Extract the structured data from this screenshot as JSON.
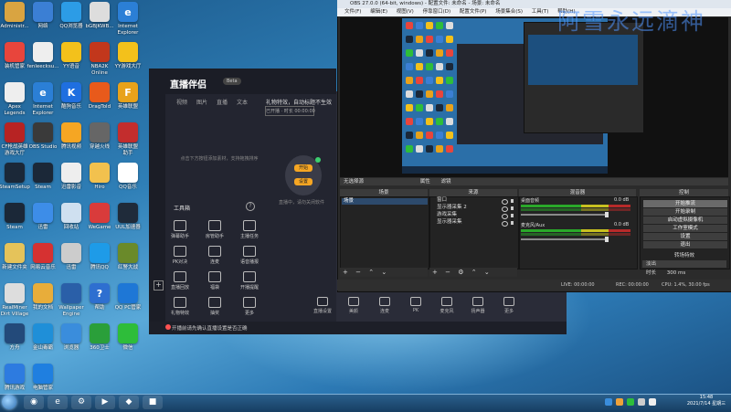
{
  "desktop_icons": [
    {
      "label": "Administr...",
      "color": "#d9a441",
      "glyph": ""
    },
    {
      "label": "网络",
      "color": "#3b7fd4",
      "glyph": ""
    },
    {
      "label": "QQ浏览器",
      "color": "#2c9ce6",
      "glyph": ""
    },
    {
      "label": "bGBJKWB...",
      "color": "#dddddd",
      "glyph": ""
    },
    {
      "label": "Internet\nExplorer",
      "color": "#2b7fd6",
      "glyph": "e"
    },
    {
      "label": "装机管家",
      "color": "#e8453c",
      "glyph": ""
    },
    {
      "label": "fenleecksu...",
      "color": "#eeeeee",
      "glyph": ""
    },
    {
      "label": "YY语音",
      "color": "#f3c11b",
      "glyph": ""
    },
    {
      "label": "NBA2K\nOnline",
      "color": "#c2371c",
      "glyph": ""
    },
    {
      "label": "YY游戏大厅",
      "color": "#f3c11b",
      "glyph": ""
    },
    {
      "label": "Apex\nLegends",
      "color": "#eeeeee",
      "glyph": ""
    },
    {
      "label": "Internet\nExplorer",
      "color": "#2b7fd6",
      "glyph": "e"
    },
    {
      "label": "酷狗音乐",
      "color": "#1f6fe0",
      "glyph": "K"
    },
    {
      "label": "DragTold",
      "color": "#e85a1b",
      "glyph": ""
    },
    {
      "label": "英雄联盟",
      "color": "#e8a21b",
      "glyph": "F"
    },
    {
      "label": "CF枪战英雄\n游戏大厅",
      "color": "#b72323",
      "glyph": ""
    },
    {
      "label": "OBS Studio",
      "color": "#3a3a3a",
      "glyph": ""
    },
    {
      "label": "腾讯视频",
      "color": "#f5a623",
      "glyph": ""
    },
    {
      "label": "穿越火线",
      "color": "#666666",
      "glyph": ""
    },
    {
      "label": "英雄联盟\n助手",
      "color": "#c32d2d",
      "glyph": ""
    },
    {
      "label": "SteamSetup",
      "color": "#1b2838",
      "glyph": ""
    },
    {
      "label": "Steam",
      "color": "#1b2838",
      "glyph": ""
    },
    {
      "label": "迅雷影音",
      "color": "#eeeeee",
      "glyph": ""
    },
    {
      "label": "Hiro",
      "color": "#f2c14e",
      "glyph": ""
    },
    {
      "label": "QQ音乐",
      "color": "#ffffff",
      "glyph": ""
    },
    {
      "label": "Steam",
      "color": "#1b2838",
      "glyph": ""
    },
    {
      "label": "迅雷",
      "color": "#3d8de8",
      "glyph": ""
    },
    {
      "label": "回收站",
      "color": "#cfe0f0",
      "glyph": ""
    },
    {
      "label": "WeGame",
      "color": "#d93b3b",
      "glyph": ""
    },
    {
      "label": "UUL加速器",
      "color": "#1f2b3a",
      "glyph": ""
    },
    {
      "label": "新建文件夹",
      "color": "#e5c35a",
      "glyph": ""
    },
    {
      "label": "网易云音乐",
      "color": "#d63131",
      "glyph": ""
    },
    {
      "label": "迅雷",
      "color": "#cccccc",
      "glyph": ""
    },
    {
      "label": "腾讯QQ",
      "color": "#1e9be8",
      "glyph": ""
    },
    {
      "label": "红警大战",
      "color": "#6a8a2a",
      "glyph": ""
    },
    {
      "label": "RealMiner\nDirt Village",
      "color": "#dddddd",
      "glyph": ""
    },
    {
      "label": "我的文档",
      "color": "#e8ad3a",
      "glyph": ""
    },
    {
      "label": "Wallpaper\nEngine",
      "color": "#2a5fa8",
      "glyph": ""
    },
    {
      "label": "帮助",
      "color": "#2e6fd0",
      "glyph": "?"
    },
    {
      "label": "QQ PC管家",
      "color": "#1e77d6",
      "glyph": ""
    },
    {
      "label": "方舟",
      "color": "#234a7a",
      "glyph": ""
    },
    {
      "label": "金山毒霸",
      "color": "#1f8fd8",
      "glyph": ""
    },
    {
      "label": "浏览器",
      "color": "#3a8ddc",
      "glyph": ""
    },
    {
      "label": "360卫士",
      "color": "#2a9f3a",
      "glyph": ""
    },
    {
      "label": "微信",
      "color": "#2ebd3a",
      "glyph": ""
    },
    {
      "label": "腾讯游戏",
      "color": "#2d7be0",
      "glyph": ""
    },
    {
      "label": "电脑管家",
      "color": "#1f7fe0",
      "glyph": ""
    }
  ],
  "stream_app": {
    "brand": "直播伴侣",
    "brand_badge": "Beta",
    "tabs": [
      "视频",
      "图片",
      "直播",
      "文本"
    ],
    "right_header": "礼物特效，自动标题不生效",
    "right_sub": "已开播 · 时长 00:00:00",
    "empty_hint": "点击下方按钮添加素材，支持拖拽排序",
    "toolbox_title": "工具箱",
    "tools": [
      {
        "label": "弹幕助手"
      },
      {
        "label": "房管助手"
      },
      {
        "label": "主播任务"
      },
      {
        "label": "PK对决"
      },
      {
        "label": "连麦"
      },
      {
        "label": "语音播报"
      },
      {
        "label": "直播回放"
      },
      {
        "label": "福袋"
      },
      {
        "label": "开播提醒"
      },
      {
        "label": "礼物特效"
      },
      {
        "label": "抽奖"
      },
      {
        "label": "更多"
      }
    ],
    "orange_buttons": [
      "开始",
      "设置"
    ],
    "preview_hint": "直播中，请勿关闭软件",
    "controls": [
      {
        "label": "直播设置"
      },
      {
        "label": "美颜"
      },
      {
        "label": "连麦"
      },
      {
        "label": "PK"
      },
      {
        "label": "麦克风"
      },
      {
        "label": "扬声器"
      },
      {
        "label": "更多"
      }
    ],
    "bottom_warning": "开播前请先确认直播设置是否正确"
  },
  "obs": {
    "title": "OBS 27.0.0 (64-bit, windows) - 配置文件: 未命名 - 场景: 未命名",
    "menu": [
      "文件(F)",
      "编辑(E)",
      "视图(V)",
      "停靠窗口(D)",
      "配置文件(P)",
      "场景集合(S)",
      "工具(T)",
      "帮助(H)"
    ],
    "source_bar": [
      "属性",
      "滤镜"
    ],
    "source_bar_label": "无选择源",
    "docks": {
      "scenes": "场景",
      "sources": "来源",
      "mixer": "混音器",
      "controls": "控制"
    },
    "scenes": [
      "场景"
    ],
    "sources": [
      "窗口",
      "显示器采集 2",
      "游戏采集",
      "显示器采集"
    ],
    "mixer": [
      {
        "name": "桌面音频",
        "db": "0.0 dB"
      },
      {
        "name": "麦克风/Aux",
        "db": "0.0 dB"
      }
    ],
    "controls": [
      "开始推流",
      "开始录制",
      "启动虚拟摄像机",
      "工作室模式",
      "设置",
      "退出"
    ],
    "transition_label": "转场特效",
    "transition_value": "淡出",
    "duration_label": "时长",
    "duration_value": "300 ms",
    "status": {
      "live": "LIVE: 00:00:00",
      "rec": "REC: 00:00:00",
      "cpu": "CPU: 1.4%, 30.00 fps"
    }
  },
  "watermark": "阿雪永远滴神",
  "taskbar": {
    "apps": [
      "◉",
      "e",
      "⚙",
      "▶",
      "◆",
      "■"
    ],
    "clock_time": "15:48",
    "clock_date": "2021/7/14 星期三"
  }
}
